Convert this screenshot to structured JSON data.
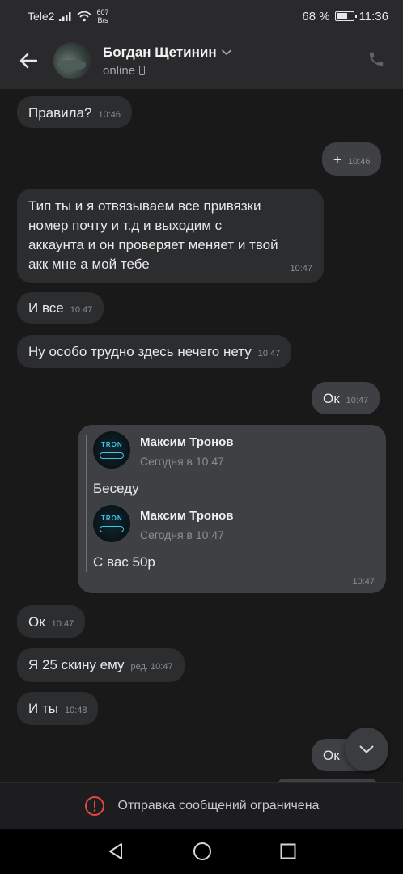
{
  "statusbar": {
    "carrier": "Tele2",
    "speed_value": "607",
    "speed_unit": "B/s",
    "battery_percent": "68 %",
    "battery_level": 0.68,
    "time": "11:36"
  },
  "header": {
    "name": "Богдан Щетинин",
    "status": "online"
  },
  "messages": [
    {
      "dir": "in",
      "text": "Правила?",
      "time": "10:46"
    },
    {
      "dir": "out",
      "text": "+",
      "time": "10:46"
    },
    {
      "dir": "in",
      "lines": [
        "Тип ты и я отвязываем все привязки",
        "номер почту и т.д и выходим с",
        "аккаунта и он проверяет меняет и твой",
        "акк мне а мой тебе"
      ],
      "time": "10:47"
    },
    {
      "dir": "in",
      "text": "И все",
      "time": "10:47"
    },
    {
      "dir": "in",
      "text": "Ну особо трудно здесь нечего нету",
      "time": "10:47"
    },
    {
      "dir": "out",
      "text": "Ок",
      "time": "10:47"
    },
    {
      "dir": "in",
      "text": "Ок",
      "time": "10:47"
    },
    {
      "dir": "in",
      "text": "Я 25 скину ему",
      "time": "ред. 10:47"
    },
    {
      "dir": "in",
      "text": "И ты",
      "time": "10:48"
    },
    {
      "dir": "out",
      "text": "Ок",
      "time": ""
    }
  ],
  "forwarded": {
    "time": "10:47",
    "items": [
      {
        "author": "Максим Тронов",
        "date": "Сегодня в 10:47",
        "text": "Беседу",
        "avatar_label": "TRON"
      },
      {
        "author": "Максим Тронов",
        "date": "Сегодня в 10:47",
        "text": "С вас 50р",
        "avatar_label": "TRON"
      }
    ]
  },
  "restriction": {
    "text": "Отправка сообщений ограничена"
  },
  "colors": {
    "background": "#19191a",
    "incoming_bubble": "#2c2d2f",
    "outgoing_bubble": "#3e4043",
    "warning_red": "#e64646",
    "tron_accent": "#3ec7e8"
  },
  "icons": [
    "back-arrow-icon",
    "chevron-down-icon",
    "mobile-device-icon",
    "phone-icon",
    "chevron-down-icon",
    "alert-circle-icon",
    "nav-back-icon",
    "nav-home-icon",
    "nav-recents-icon"
  ]
}
